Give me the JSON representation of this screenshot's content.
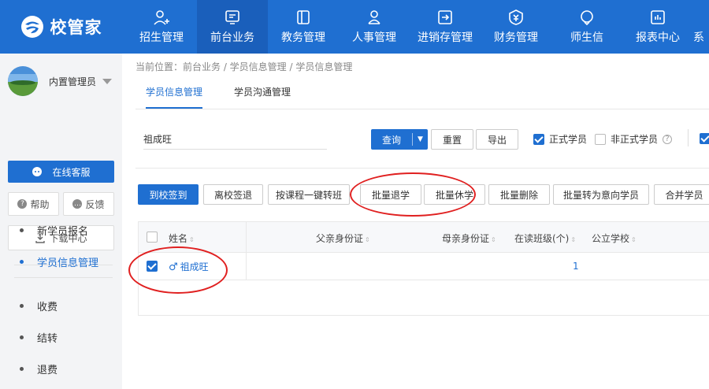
{
  "brand": {
    "name": "校管家"
  },
  "nav": [
    {
      "label": "招生管理",
      "icon": "user-add-icon"
    },
    {
      "label": "前台业务",
      "icon": "monitor-icon"
    },
    {
      "label": "教务管理",
      "icon": "book-icon"
    },
    {
      "label": "人事管理",
      "icon": "person-icon"
    },
    {
      "label": "进销存管理",
      "icon": "inventory-icon"
    },
    {
      "label": "财务管理",
      "icon": "finance-icon"
    },
    {
      "label": "师生信",
      "icon": "message-icon"
    },
    {
      "label": "报表中心",
      "icon": "report-icon"
    },
    {
      "label": "系"
    }
  ],
  "nav_active": "前台业务",
  "sidebar": {
    "user_name": "内置管理员",
    "online_service": "在线客服",
    "help": "帮助",
    "feedback": "反馈",
    "download_center": "下载中心",
    "menu": [
      "新学员报名",
      "学员信息管理",
      "收费",
      "结转",
      "退费"
    ],
    "active_menu": "学员信息管理"
  },
  "breadcrumb": "当前位置：前台业务 / 学员信息管理 / 学员信息管理",
  "tabs": [
    "学员信息管理",
    "学员沟通管理"
  ],
  "search": {
    "value": "祖成旺"
  },
  "buttons": {
    "query": "查询",
    "reset": "重置",
    "export": "导出",
    "checkin": "到校签到",
    "checkout": "离校签退",
    "transfer": "按课程一键转班",
    "batch_withdraw": "批量退学",
    "batch_suspend": "批量休学",
    "batch_delete": "批量删除",
    "batch_to_intent": "批量转为意向学员",
    "merge": "合并学员"
  },
  "filters": {
    "formal": {
      "label": "正式学员",
      "checked": true
    },
    "informal": {
      "label": "非正式学员",
      "checked": false
    }
  },
  "table": {
    "columns": [
      "姓名",
      "父亲身份证",
      "母亲身份证",
      "在读班级(个)",
      "公立学校"
    ],
    "rows": [
      {
        "name": "祖成旺",
        "classes": "1",
        "checked": true
      }
    ]
  },
  "colors": {
    "brand": "#1f6fd1",
    "highlight_oval": "#e02020"
  }
}
